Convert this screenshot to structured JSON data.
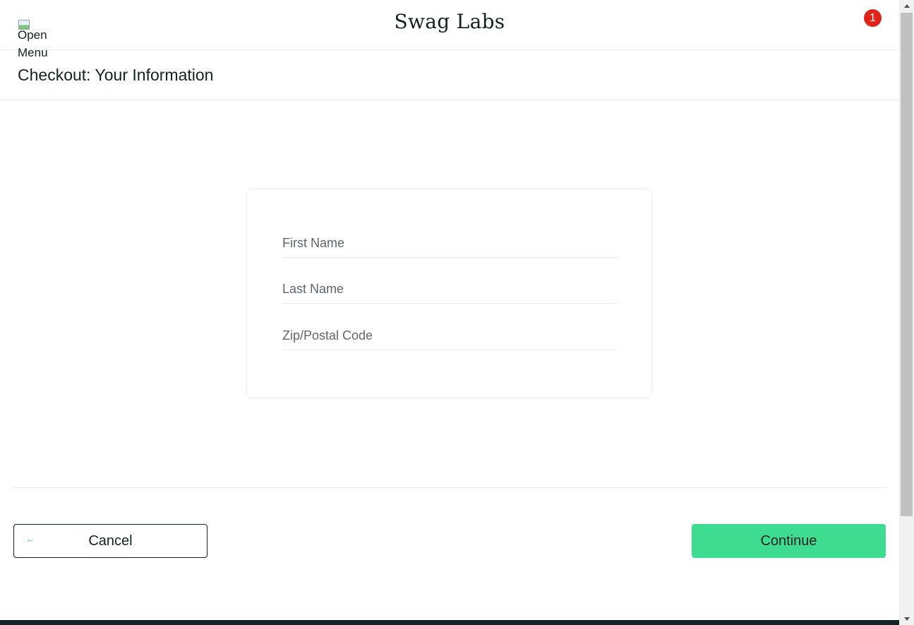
{
  "header": {
    "logo": "Swag Labs",
    "menu_image_alt": "Open Menu",
    "cart_count": "1"
  },
  "page": {
    "title": "Checkout: Your Information"
  },
  "form": {
    "first_name_placeholder": "First Name",
    "last_name_placeholder": "Last Name",
    "postal_code_placeholder": "Zip/Postal Code",
    "first_name_value": "",
    "last_name_value": "",
    "postal_code_value": ""
  },
  "actions": {
    "cancel_label": "Cancel",
    "continue_label": "Continue"
  },
  "colors": {
    "accent": "#3ddc91",
    "badge": "#e2231a",
    "text": "#132322",
    "border": "#ededed"
  }
}
